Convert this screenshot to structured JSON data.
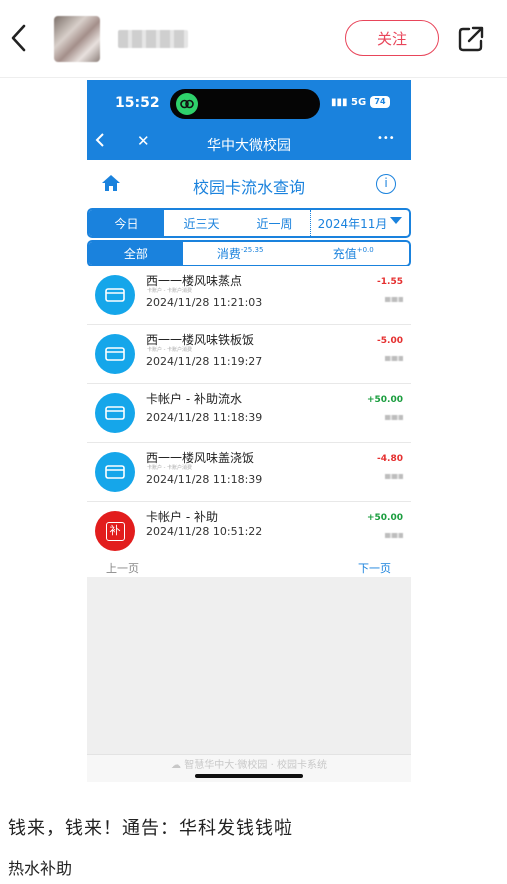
{
  "header": {
    "follow_label": "关注",
    "icons": {
      "back": "chevron-left-icon",
      "share": "share-external-icon"
    }
  },
  "phone": {
    "status": {
      "time": "15:52",
      "signal": "5G",
      "battery": "74"
    },
    "nav": {
      "title": "华中大微校园",
      "close": "✕",
      "more": "•••"
    },
    "page_title": "校园卡流水查询",
    "tabs_top": [
      {
        "label": "今日",
        "active": true
      },
      {
        "label": "近三天",
        "active": false
      },
      {
        "label": "近一周",
        "active": false
      },
      {
        "label": "2024年11月",
        "active": false
      }
    ],
    "tabs_bottom": {
      "all": "全部",
      "spend": "消费",
      "spend_sum": "-25.35",
      "topup": "充值",
      "topup_sum": "+0.0"
    },
    "transactions": [
      {
        "name": "西一一楼风味蒸点",
        "sub": "卡账户 - 卡账户消费",
        "time": "2024/11/28 11:21:03",
        "amount": "-1.55",
        "type": "card"
      },
      {
        "name": "西一一楼风味铁板饭",
        "sub": "卡账户 - 卡账户消费",
        "time": "2024/11/28 11:19:27",
        "amount": "-5.00",
        "type": "card"
      },
      {
        "name": "卡帐户 - 补助流水",
        "sub": "",
        "time": "2024/11/28 11:18:39",
        "amount": "+50.00",
        "type": "card"
      },
      {
        "name": "西一一楼风味盖浇饭",
        "sub": "卡账户 - 卡账户消费",
        "time": "2024/11/28 11:18:39",
        "amount": "-4.80",
        "type": "card"
      },
      {
        "name": "卡帐户 - 补助",
        "sub": "",
        "time": "2024/11/28 10:51:22",
        "amount": "+50.00",
        "type": "subsidy",
        "badge": "补"
      }
    ],
    "pager": {
      "prev": "上一页",
      "next": "下一页"
    },
    "footer": "智慧华中大·微校园 · 校园卡系统"
  },
  "caption": {
    "line1": "钱来，钱来！通告：华科发钱钱啦",
    "line2": "热水补助"
  },
  "colors": {
    "accent": "#1a82dd",
    "follow": "#e8455a",
    "negative": "#e53030",
    "positive": "#1a9d3e"
  }
}
